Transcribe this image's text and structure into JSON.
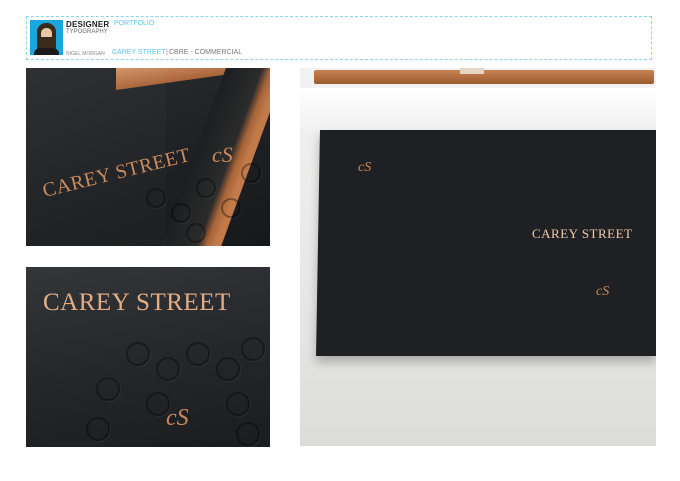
{
  "header": {
    "role": "DESIGNER",
    "discipline": "TYPOGRAPHY",
    "section": "PORTFOLIO",
    "name": "NIGEL MORGAN",
    "project": "CAREY STREET",
    "separator": "|",
    "client": "CBRE - COMMERCIAL"
  },
  "photos": {
    "brand_text": "CAREY STREET",
    "monogram": "cS"
  },
  "colors": {
    "accent": "#58c6e6",
    "copper": "#c98a5c",
    "cover": "#1e2023"
  }
}
